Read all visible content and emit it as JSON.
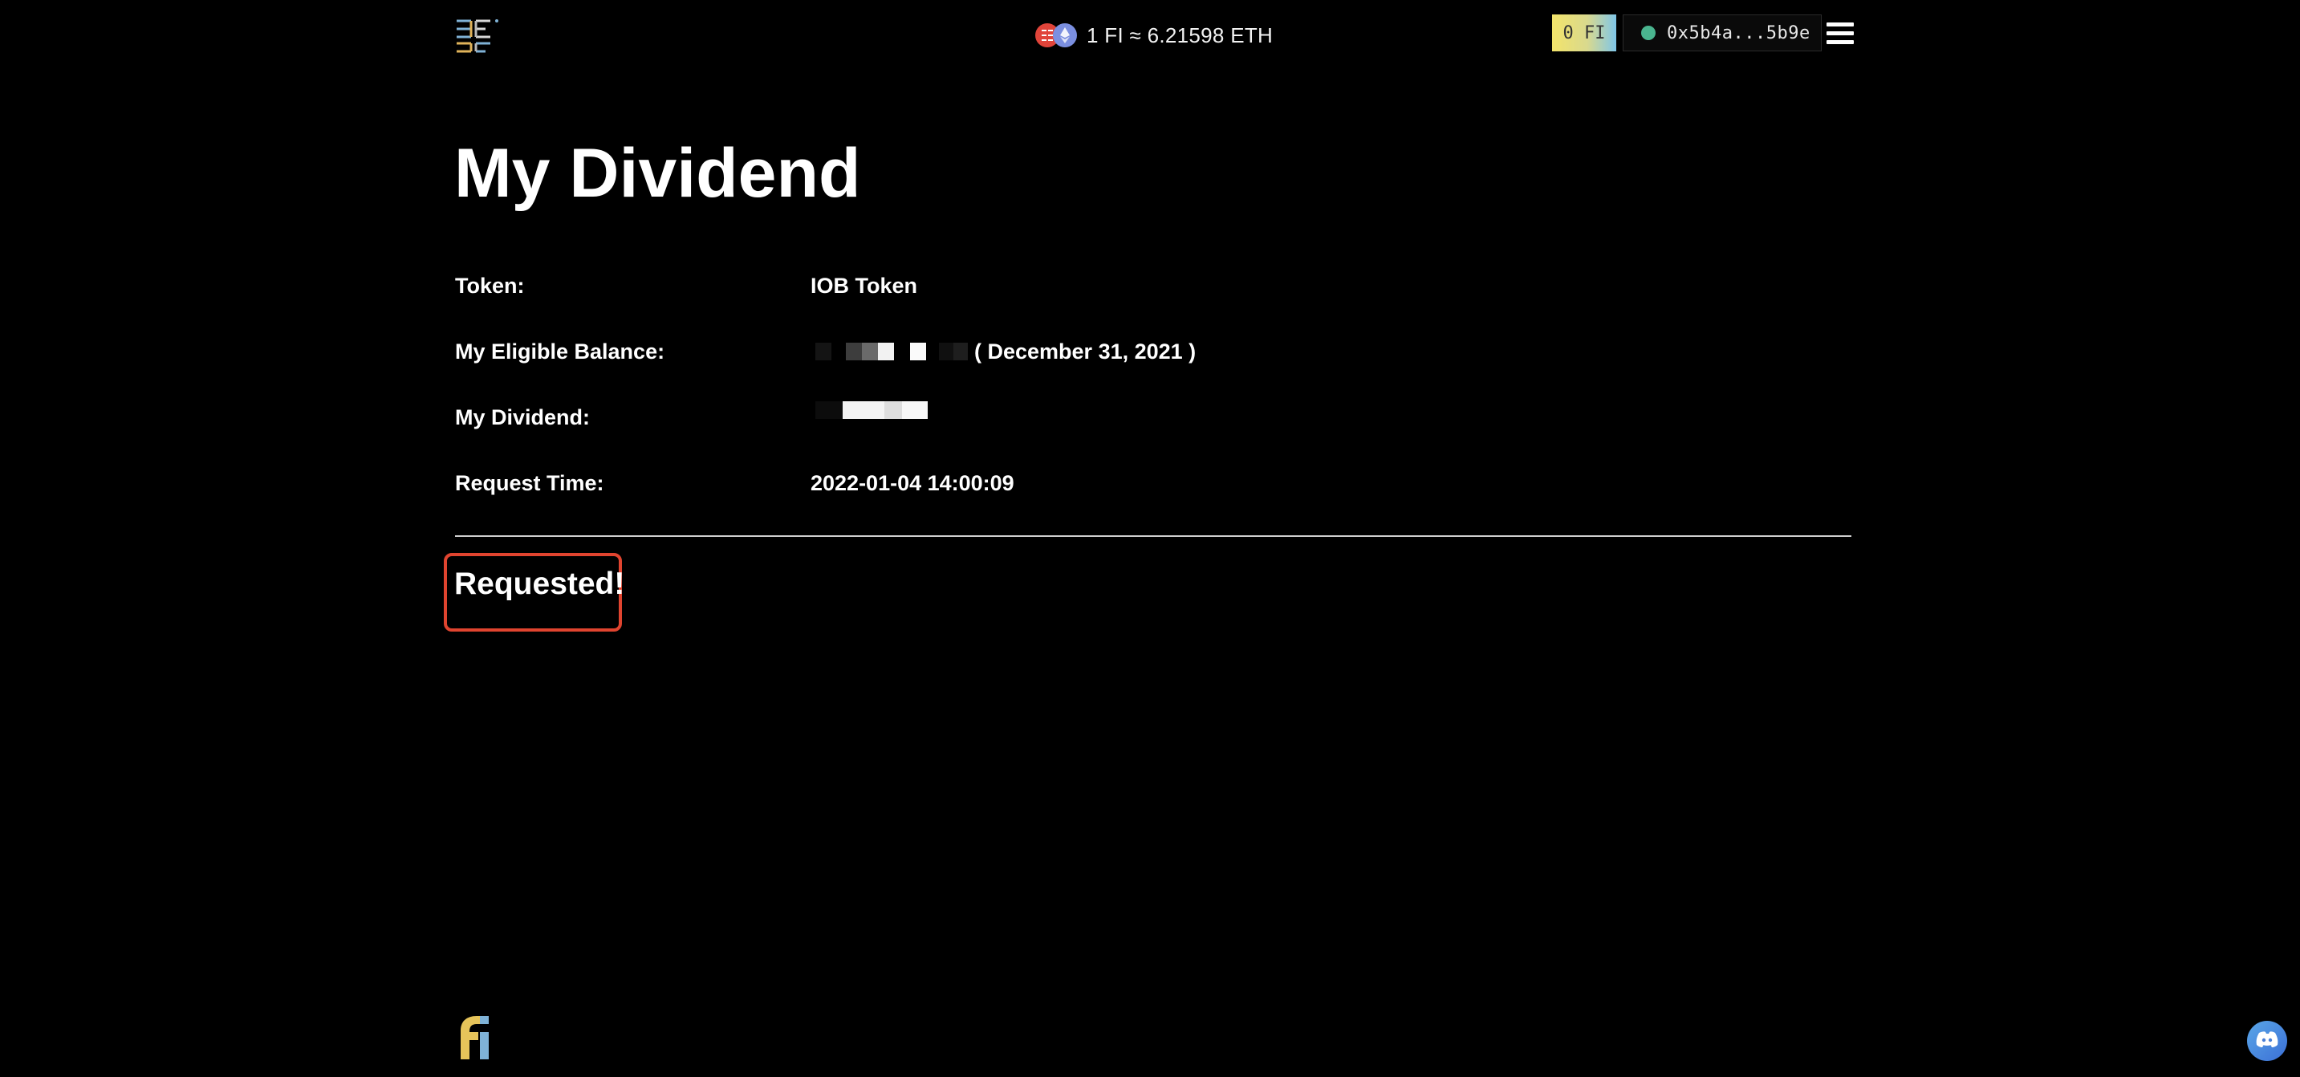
{
  "header": {
    "logo_icon": "fi-brand-logo-icon",
    "rate_text": "1 FI ≈ 6.21598 ETH",
    "rate_icons": [
      "fi-coin-icon",
      "eth-coin-icon"
    ],
    "fi_balance": "0 FI",
    "wallet_address": "0x5b4a...5b9e",
    "wallet_status_color": "#4ab58f",
    "menu_icon": "hamburger-menu-icon"
  },
  "main": {
    "title": "My Dividend",
    "rows": [
      {
        "label": "Token:",
        "value": "IOB Token"
      },
      {
        "label": "My Eligible Balance:",
        "value": "( December 31, 2021 )",
        "value_redacted": true
      },
      {
        "label": "My Dividend:",
        "value": "",
        "value_redacted": true
      },
      {
        "label": "Request Time:",
        "value": "2022-01-04 14:00:09"
      }
    ],
    "status": "Requested!",
    "status_highlight_color": "#e0442f"
  },
  "footer": {
    "logo_icon": "fi-footer-logo-icon",
    "chat_icon": "discord-icon",
    "chat_button_color": "#4a8ae0"
  }
}
